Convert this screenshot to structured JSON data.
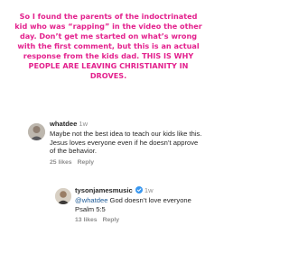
{
  "caption": "So I found the parents of the indoctrinated kid who was “rapping” in the video the other day. Don’t get me started on what’s wrong with the first comment, but this is an actual response from the kids dad. THIS IS WHY PEOPLE ARE LEAVING CHRISTIANITY IN DROVES.",
  "comments": [
    {
      "username": "whatdee",
      "time": "1w",
      "text": "Maybe not the best idea to teach our kids like this. Jesus loves everyone even if he doesn’t approve of the behavior.",
      "likes": "25 likes",
      "reply_label": "Reply"
    },
    {
      "username": "tysonjamesmusic",
      "verified_icon": "verified-badge-icon",
      "time": "1w",
      "mention": "@whatdee",
      "text": " God doesn’t love everyone Psalm 5:5",
      "likes": "13 likes",
      "reply_label": "Reply"
    }
  ],
  "colors": {
    "caption": "#e3218d",
    "username": "#262626",
    "muted": "#8e8e8e",
    "mention": "#1d5a96",
    "verified": "#3897f0"
  }
}
